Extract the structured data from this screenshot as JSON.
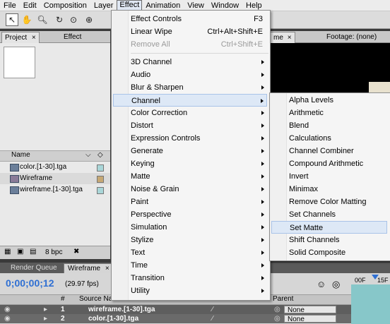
{
  "menubar": {
    "items": [
      "File",
      "Edit",
      "Composition",
      "Layer",
      "Effect",
      "Animation",
      "View",
      "Window",
      "Help"
    ],
    "active": "Effect"
  },
  "toolbar": {
    "tools": [
      "selection-tool",
      "hand-tool",
      "zoom-tool",
      "rotate-tool",
      "camera-orbit-tool",
      "pan-behind-tool"
    ]
  },
  "project_panel": {
    "tab_project": "Project",
    "tab_effect_controls": "Effect Controls:",
    "column_name": "Name",
    "items": [
      {
        "label": "color.[1-30].tga",
        "icon": "footage-icon",
        "swatch": "#a9d6d8"
      },
      {
        "label": "Wireframe",
        "icon": "composition-icon",
        "swatch": "#c6a874"
      },
      {
        "label": "wireframe.[1-30].tga",
        "icon": "footage-icon",
        "swatch": "#a9d6d8"
      }
    ],
    "bpc": "8 bpc"
  },
  "viewer": {
    "tab_comp": "me",
    "tab_footage": "Footage: (none)"
  },
  "effect_menu": {
    "items": [
      {
        "label": "Effect Controls",
        "shortcut": "F3"
      },
      {
        "label": "Linear Wipe",
        "shortcut": "Ctrl+Alt+Shift+E"
      },
      {
        "label": "Remove All",
        "shortcut": "Ctrl+Shift+E",
        "disabled": true
      },
      {
        "label": "3D Channel",
        "submenu": true
      },
      {
        "label": "Audio",
        "submenu": true
      },
      {
        "label": "Blur & Sharpen",
        "submenu": true
      },
      {
        "label": "Channel",
        "submenu": true,
        "highlighted": true
      },
      {
        "label": "Color Correction",
        "submenu": true
      },
      {
        "label": "Distort",
        "submenu": true
      },
      {
        "label": "Expression Controls",
        "submenu": true
      },
      {
        "label": "Generate",
        "submenu": true
      },
      {
        "label": "Keying",
        "submenu": true
      },
      {
        "label": "Matte",
        "submenu": true
      },
      {
        "label": "Noise & Grain",
        "submenu": true
      },
      {
        "label": "Paint",
        "submenu": true
      },
      {
        "label": "Perspective",
        "submenu": true
      },
      {
        "label": "Simulation",
        "submenu": true
      },
      {
        "label": "Stylize",
        "submenu": true
      },
      {
        "label": "Text",
        "submenu": true
      },
      {
        "label": "Time",
        "submenu": true
      },
      {
        "label": "Transition",
        "submenu": true
      },
      {
        "label": "Utility",
        "submenu": true
      }
    ]
  },
  "channel_submenu": {
    "items": [
      {
        "label": "Alpha Levels"
      },
      {
        "label": "Arithmetic"
      },
      {
        "label": "Blend"
      },
      {
        "label": "Calculations"
      },
      {
        "label": "Channel Combiner"
      },
      {
        "label": "Compound Arithmetic"
      },
      {
        "label": "Invert"
      },
      {
        "label": "Minimax"
      },
      {
        "label": "Remove Color Matting"
      },
      {
        "label": "Set Channels"
      },
      {
        "label": "Set Matte",
        "highlighted": true
      },
      {
        "label": "Shift Channels"
      },
      {
        "label": "Solid Composite"
      }
    ]
  },
  "timeline": {
    "tab_render_queue": "Render Queue",
    "tab_wireframe": "Wireframe",
    "timecode": "0;00;00;12",
    "fps": "(29.97 fps)",
    "col_hash": "#",
    "col_source": "Source Name",
    "col_parent": "Parent",
    "ruler_start": "00F",
    "ruler_mark": "15F",
    "layers": [
      {
        "num": "1",
        "name": "wireframe.[1-30].tga",
        "parent": "None"
      },
      {
        "num": "2",
        "name": "color.[1-30].tga",
        "parent": "None"
      }
    ]
  }
}
